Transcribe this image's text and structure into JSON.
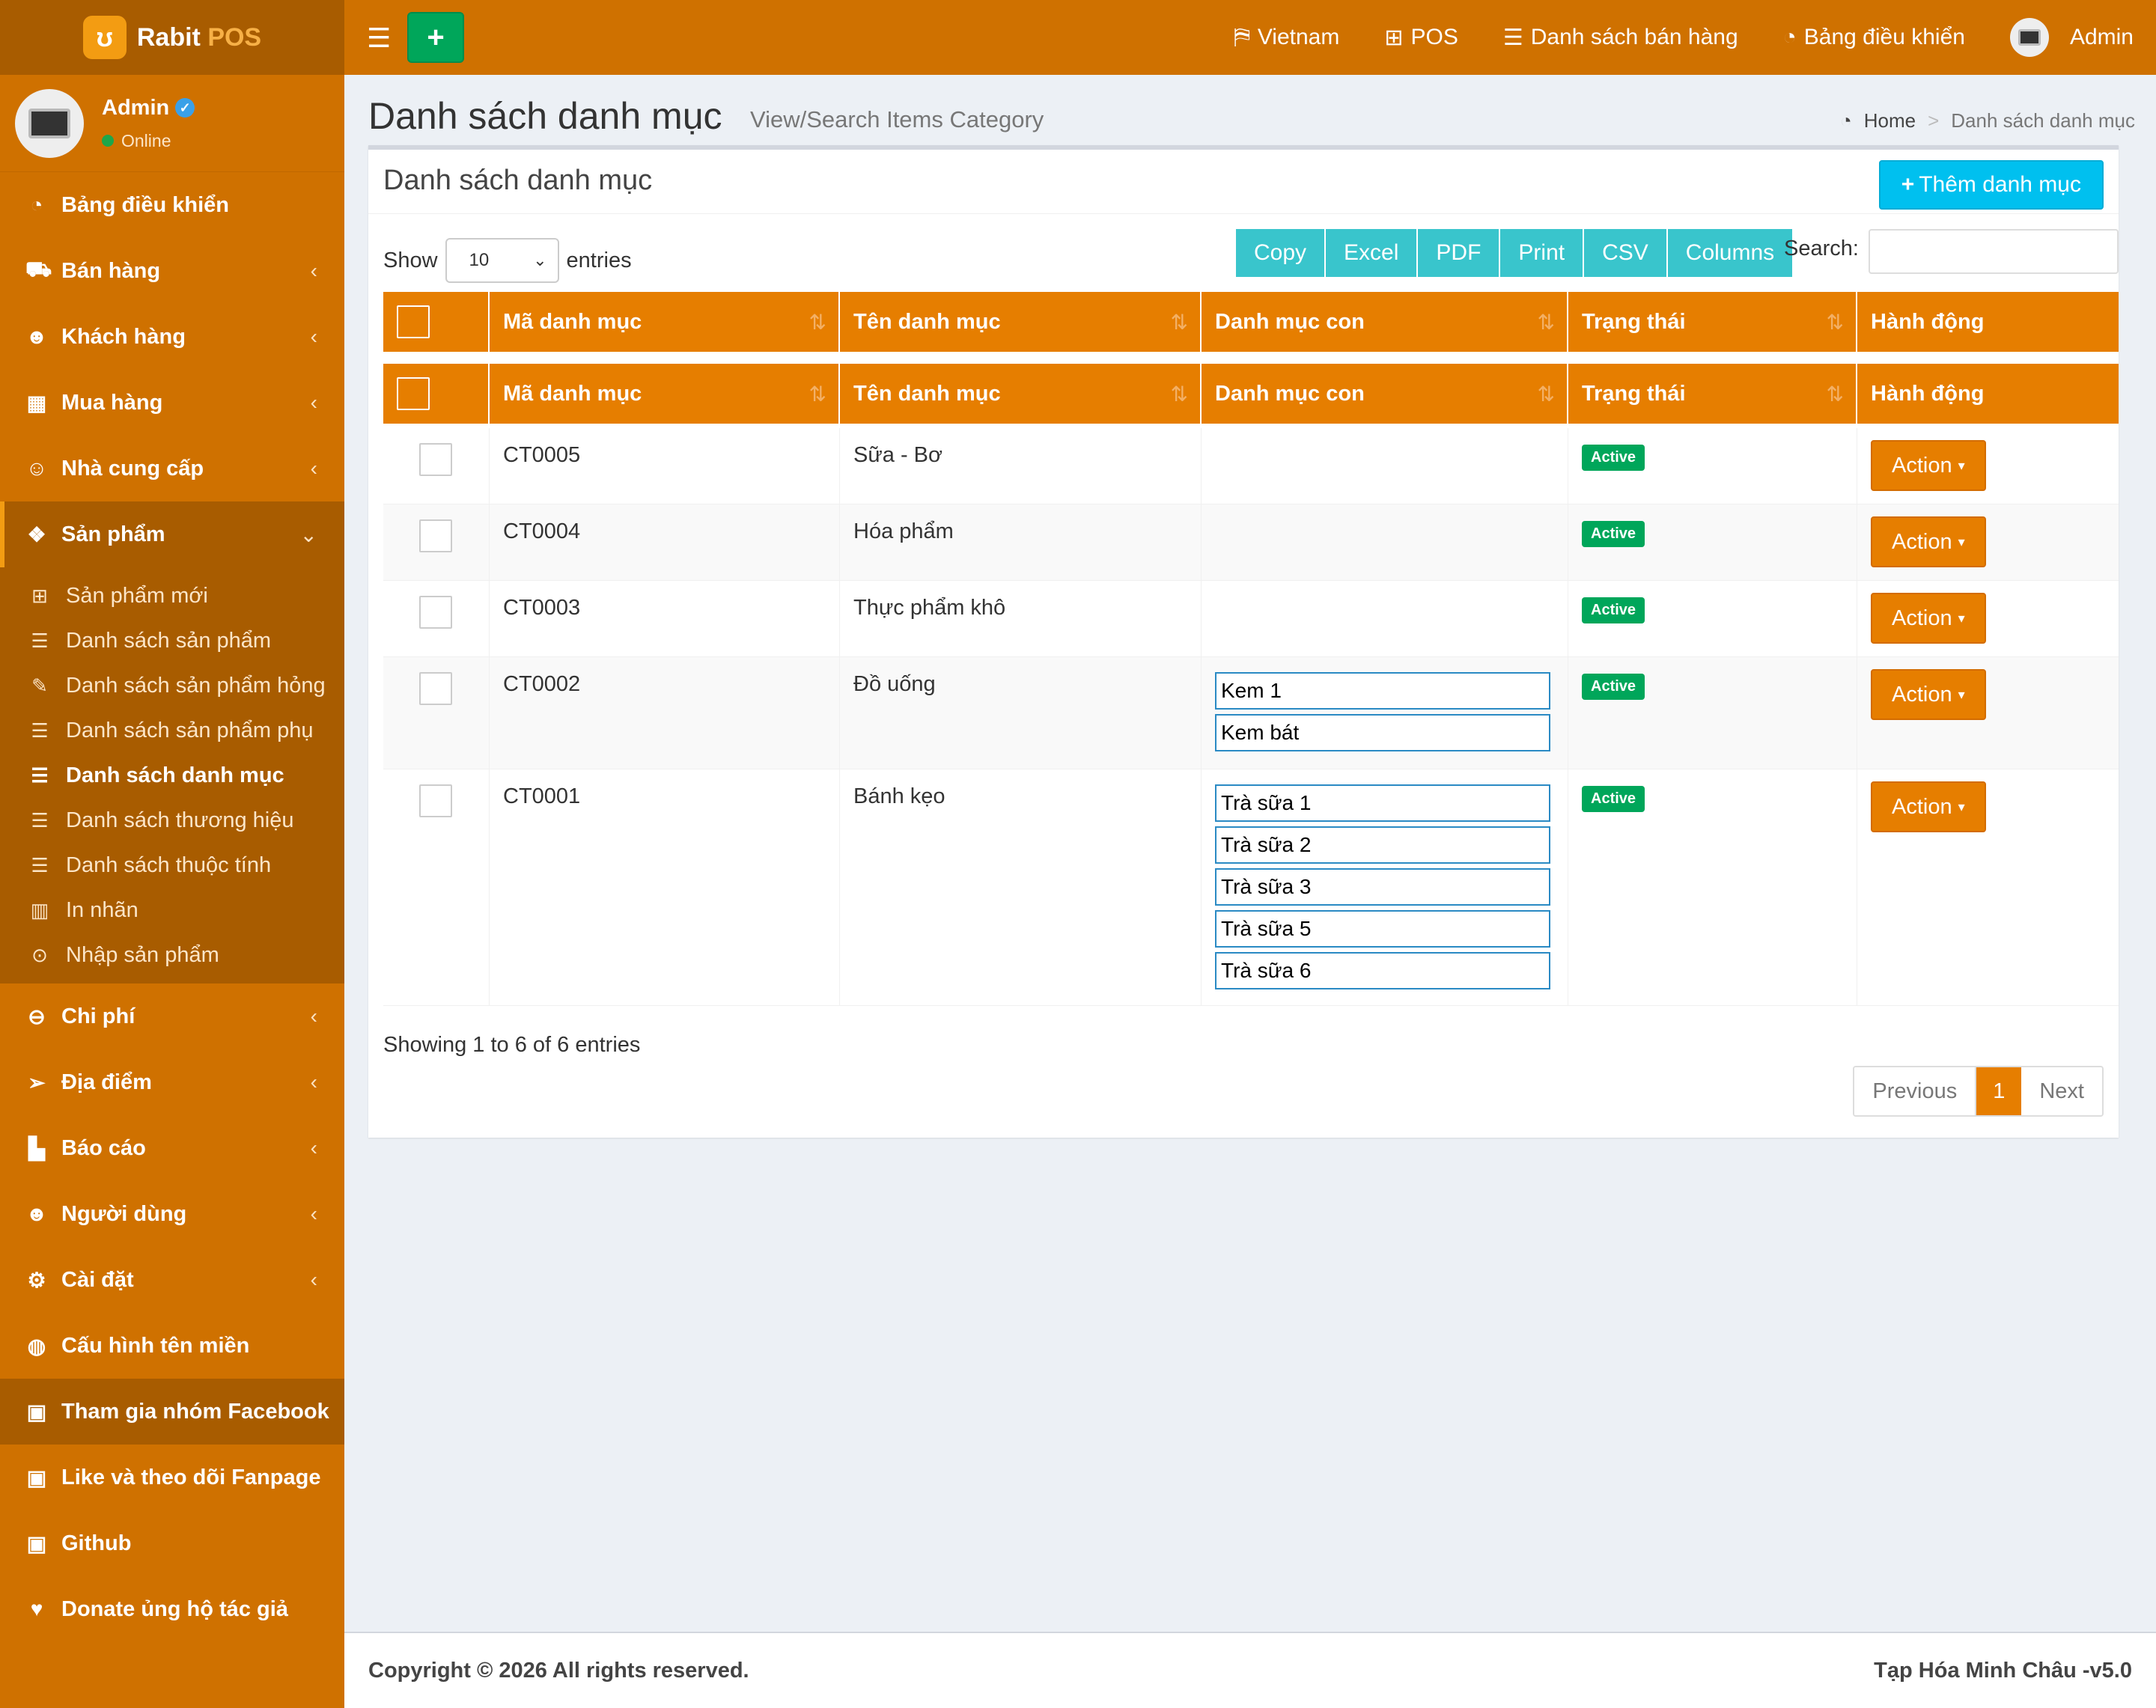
{
  "brand": {
    "name": "Rabit",
    "suffix": "POS",
    "logo_icon": "rabbit-icon"
  },
  "user": {
    "name": "Admin",
    "status": "Online"
  },
  "sidebar": {
    "items": [
      {
        "label": "Bảng điều khiển",
        "icon": "dashboard-icon"
      },
      {
        "label": "Bán hàng",
        "icon": "cart-icon"
      },
      {
        "label": "Khách hàng",
        "icon": "users-icon"
      },
      {
        "label": "Mua hàng",
        "icon": "grid-icon"
      },
      {
        "label": "Nhà cung cấp",
        "icon": "user-plus-icon"
      },
      {
        "label": "Sản phẩm",
        "icon": "cubes-icon"
      }
    ],
    "submenu": [
      {
        "label": "Sản phẩm mới",
        "icon": "plus-square-icon"
      },
      {
        "label": "Danh sách sản phẩm",
        "icon": "list-icon"
      },
      {
        "label": "Danh sách sản phẩm hỏng",
        "icon": "wrench-icon"
      },
      {
        "label": "Danh sách sản phẩm phụ",
        "icon": "list-icon"
      },
      {
        "label": "Danh sách danh mục",
        "icon": "list-icon"
      },
      {
        "label": "Danh sách thương hiệu",
        "icon": "list-icon"
      },
      {
        "label": "Danh sách thuộc tính",
        "icon": "list-icon"
      },
      {
        "label": "In nhãn",
        "icon": "barcode-icon"
      },
      {
        "label": "Nhập sản phẩm",
        "icon": "circle-arrow-icon"
      }
    ],
    "items2": [
      {
        "label": "Chi phí",
        "icon": "minus-circle-icon"
      },
      {
        "label": "Địa điểm",
        "icon": "paper-plane-icon"
      },
      {
        "label": "Báo cáo",
        "icon": "bar-chart-icon"
      },
      {
        "label": "Người dùng",
        "icon": "users-icon"
      },
      {
        "label": "Cài đặt",
        "icon": "gears-icon"
      },
      {
        "label": "Cấu hình tên miền",
        "icon": "globe-icon"
      },
      {
        "label": "Tham gia nhóm Facebook",
        "icon": "briefcase-icon"
      },
      {
        "label": "Like và theo dõi Fanpage",
        "icon": "briefcase-icon"
      },
      {
        "label": "Github",
        "icon": "briefcase-icon"
      },
      {
        "label": "Donate ủng hộ tác giả",
        "icon": "heart-icon"
      }
    ]
  },
  "topbar": {
    "nav": [
      {
        "label": "Vietnam",
        "icon": "language-icon"
      },
      {
        "label": "POS",
        "icon": "plus-square-icon"
      },
      {
        "label": "Danh sách bán hàng",
        "icon": "list-icon"
      },
      {
        "label": "Bảng điều khiển",
        "icon": "dashboard-icon"
      }
    ],
    "user": "Admin"
  },
  "header": {
    "title": "Danh sách danh mục",
    "subtitle": "View/Search Items Category"
  },
  "breadcrumb": {
    "home": "Home",
    "sep": ">",
    "current": "Danh sách danh mục"
  },
  "box": {
    "title": "Danh sách danh mục",
    "add_label": "Thêm danh mục"
  },
  "table_controls": {
    "show": "Show",
    "entries_value": "10",
    "entries": "entries",
    "buttons": [
      "Copy",
      "Excel",
      "PDF",
      "Print",
      "CSV",
      "Columns"
    ],
    "search_label": "Search:"
  },
  "columns": [
    "Mã danh mục",
    "Tên danh mục",
    "Danh mục con",
    "Trạng thái",
    "Hành động"
  ],
  "rows": [
    {
      "code": "CT0005",
      "name": "Sữa - Bơ",
      "children": [],
      "status": "Active",
      "action": "Action"
    },
    {
      "code": "CT0004",
      "name": "Hóa phẩm",
      "children": [],
      "status": "Active",
      "action": "Action"
    },
    {
      "code": "CT0003",
      "name": "Thực phẩm khô",
      "children": [],
      "status": "Active",
      "action": "Action"
    },
    {
      "code": "CT0002",
      "name": "Đồ uống",
      "children": [
        "Kem 1",
        "Kem bát"
      ],
      "status": "Active",
      "action": "Action"
    },
    {
      "code": "CT0001",
      "name": "Bánh kẹo",
      "children": [
        "Trà sữa 1",
        "Trà sữa 2",
        "Trà sữa 3",
        "Trà sữa 5",
        "Trà sữa 6"
      ],
      "status": "Active",
      "action": "Action"
    }
  ],
  "info": "Showing 1 to 6 of 6 entries",
  "pagination": {
    "prev": "Previous",
    "page": "1",
    "next": "Next"
  },
  "footer": {
    "copyright": "Copyright © 2026 All rights reserved.",
    "version": "Tạp Hóa Minh Châu -v5.0"
  }
}
